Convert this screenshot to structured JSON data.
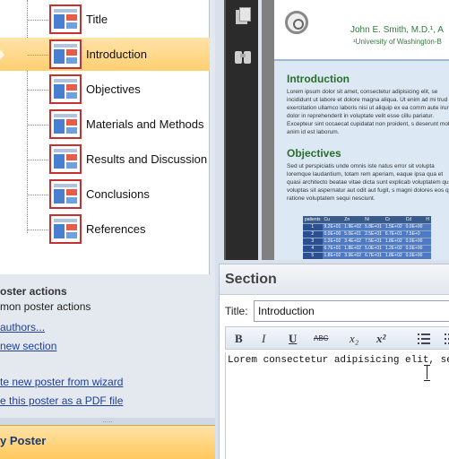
{
  "tree": {
    "items": [
      {
        "label": "Title",
        "selected": false
      },
      {
        "label": "Introduction",
        "selected": true
      },
      {
        "label": "Objectives",
        "selected": false
      },
      {
        "label": "Materials and Methods",
        "selected": false
      },
      {
        "label": "Results and Discussion",
        "selected": false
      },
      {
        "label": "Conclusions",
        "selected": false
      },
      {
        "label": "References",
        "selected": false
      }
    ]
  },
  "actions": {
    "title": "oster actions",
    "subtitle": "mon poster actions",
    "links": [
      "authors...",
      "new section",
      "te new poster from wizard",
      "e this poster as a PDF file"
    ]
  },
  "bottom_tab": {
    "label": "y Poster"
  },
  "splitter": {
    "grip": "....."
  },
  "poster": {
    "author": "John E. Smith, M.D.¹, A",
    "affiliation": "¹University of Washington-B",
    "sections": [
      {
        "heading": "Introduction",
        "text": "Lorem ipsum dolor sit amet, consectetur adipisicing elit, se incididunt ut labore et dolore magna aliqua. Ut enim ad mi trud exercitation ullamco laboris nisi ut aliquip ex ea comm aute irure dolor in reprehenderit in voluptate velit esse cillu pariatur. Excepteur sint occaecat cupidatat non proident, s deserunt mollit anim id est laborum."
      },
      {
        "heading": "Objectives",
        "text": "Sed ut perspiciatis unde omnis iste natus error sit volupta loremque laudantium, totam rem aperiam, eaque ipsa qua et quasi architecto beatae vitae dicta sunt explicab voluptatem quia voluptas sit aspernatur aut odit aut fugit, s magni dolores eos qui ratione voluptatem sequi nesciunt."
      }
    ],
    "table": {
      "headers": [
        "patients",
        "Cu",
        "Zn",
        "Ni",
        "Cr",
        "Cd",
        "H"
      ],
      "rows": [
        [
          "1",
          "9.2E+01",
          "1.9E+02",
          "5.8E+01",
          "1.5E+02",
          "0.0E+00",
          ""
        ],
        [
          "2",
          "0.0E+00",
          "5.0E+01",
          "2.5E+01",
          "6.7E+01",
          "7.5E+0",
          ""
        ],
        [
          "3",
          "1.2E+02",
          "3.4E+02",
          "7.5E+01",
          "1.8E+02",
          "0.0E+00",
          ""
        ],
        [
          "4",
          "6.7E+01",
          "1.8E+02",
          "5.0E+01",
          "1.2E+02",
          "0.0E+00",
          ""
        ],
        [
          "5",
          "1.8E+02",
          "3.9E+02",
          "6.7E+01",
          "1.8E+02",
          "0.0E+00",
          ""
        ]
      ]
    }
  },
  "section_editor": {
    "header": "Section",
    "title_label": "Title:",
    "title_value": "Introduction",
    "toolbar": {
      "bold": "B",
      "italic": "I",
      "underline": "U",
      "strike": "ABC",
      "subscript": "x₂",
      "superscript": "x²"
    },
    "body_text": "Lorem consectetur adipisicing elit, sed"
  }
}
